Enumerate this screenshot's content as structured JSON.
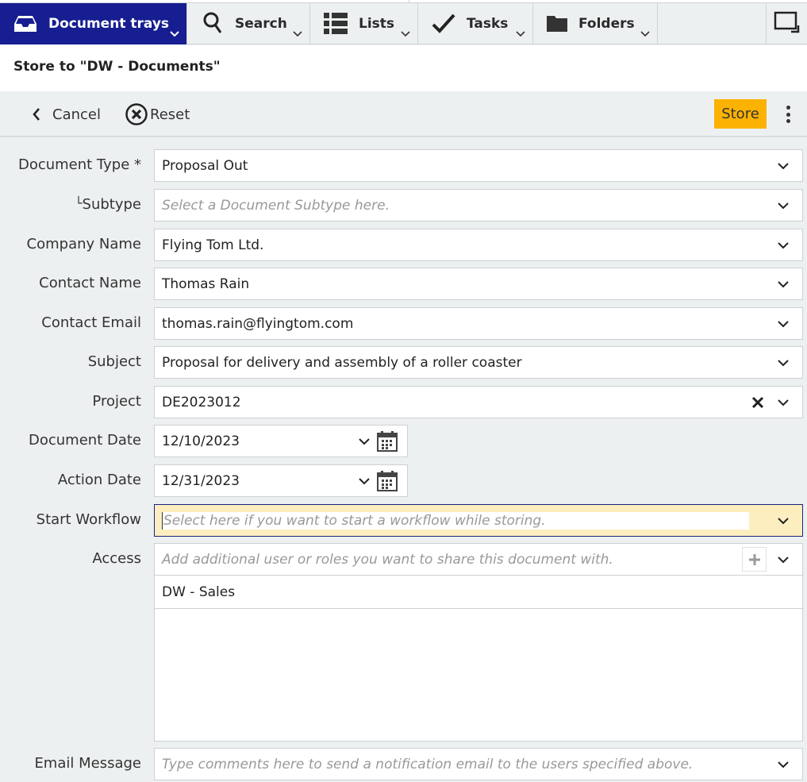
{
  "nav": {
    "tabs": [
      {
        "label": "Document trays",
        "icon": "tray-icon",
        "active": true
      },
      {
        "label": "Search",
        "icon": "search-icon",
        "active": false
      },
      {
        "label": "Lists",
        "icon": "list-icon",
        "active": false
      },
      {
        "label": "Tasks",
        "icon": "checkmark-icon",
        "active": false
      },
      {
        "label": "Folders",
        "icon": "folder-icon",
        "active": false
      }
    ],
    "right_icon": "window-resize-icon"
  },
  "page": {
    "title": "Store to \"DW - Documents\""
  },
  "toolbar": {
    "cancel_label": "Cancel",
    "reset_label": "Reset",
    "store_label": "Store",
    "accent_color": "#fbb202"
  },
  "form": {
    "document_type": {
      "label": "Document Type *",
      "value": "Proposal Out"
    },
    "subtype": {
      "label": "Subtype",
      "prefix": "└",
      "placeholder": "Select a Document Subtype here."
    },
    "company_name": {
      "label": "Company Name",
      "value": "Flying Tom Ltd."
    },
    "contact_name": {
      "label": "Contact Name",
      "value": "Thomas Rain"
    },
    "contact_email": {
      "label": "Contact Email",
      "value": "thomas.rain@flyingtom.com"
    },
    "subject": {
      "label": "Subject",
      "value": "Proposal for delivery and assembly of a roller coaster"
    },
    "project": {
      "label": "Project",
      "value": "DE2023012"
    },
    "document_date": {
      "label": "Document Date",
      "value": "12/10/2023"
    },
    "action_date": {
      "label": "Action Date",
      "value": "12/31/2023"
    },
    "start_workflow": {
      "label": "Start Workflow",
      "placeholder": "Select here if you want to start a workflow while storing."
    },
    "access": {
      "label": "Access",
      "placeholder": "Add additional user or roles you want to share this document with.",
      "items": [
        "DW - Sales"
      ]
    },
    "email_message": {
      "label": "Email Message",
      "placeholder": "Type comments here to send a notification email to the users specified above."
    }
  }
}
